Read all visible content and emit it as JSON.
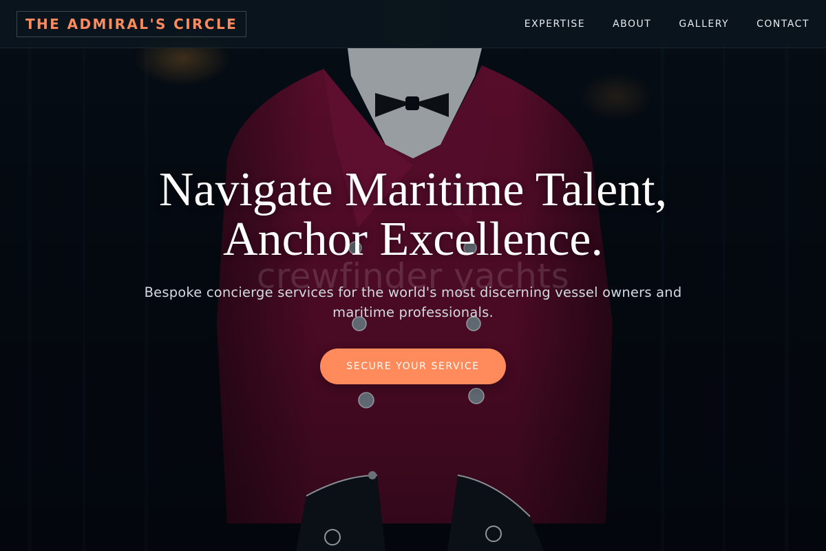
{
  "brand": {
    "name": "THE ADMIRAL'S CIRCLE",
    "accent_color": "#ff8a5b"
  },
  "nav": {
    "items": [
      {
        "label": "EXPERTISE"
      },
      {
        "label": "ABOUT"
      },
      {
        "label": "GALLERY"
      },
      {
        "label": "CONTACT"
      }
    ]
  },
  "hero": {
    "title_line1": "Navigate Maritime Talent,",
    "title_line2": "Anchor Excellence.",
    "subtitle": "Bespoke concierge services for the world's most discerning vessel owners and maritime professionals.",
    "watermark": "crewfinder yachts",
    "cta_label": "SECURE YOUR SERVICE",
    "background": "steward in crimson double-breasted jacket with bow tie, dark background"
  }
}
